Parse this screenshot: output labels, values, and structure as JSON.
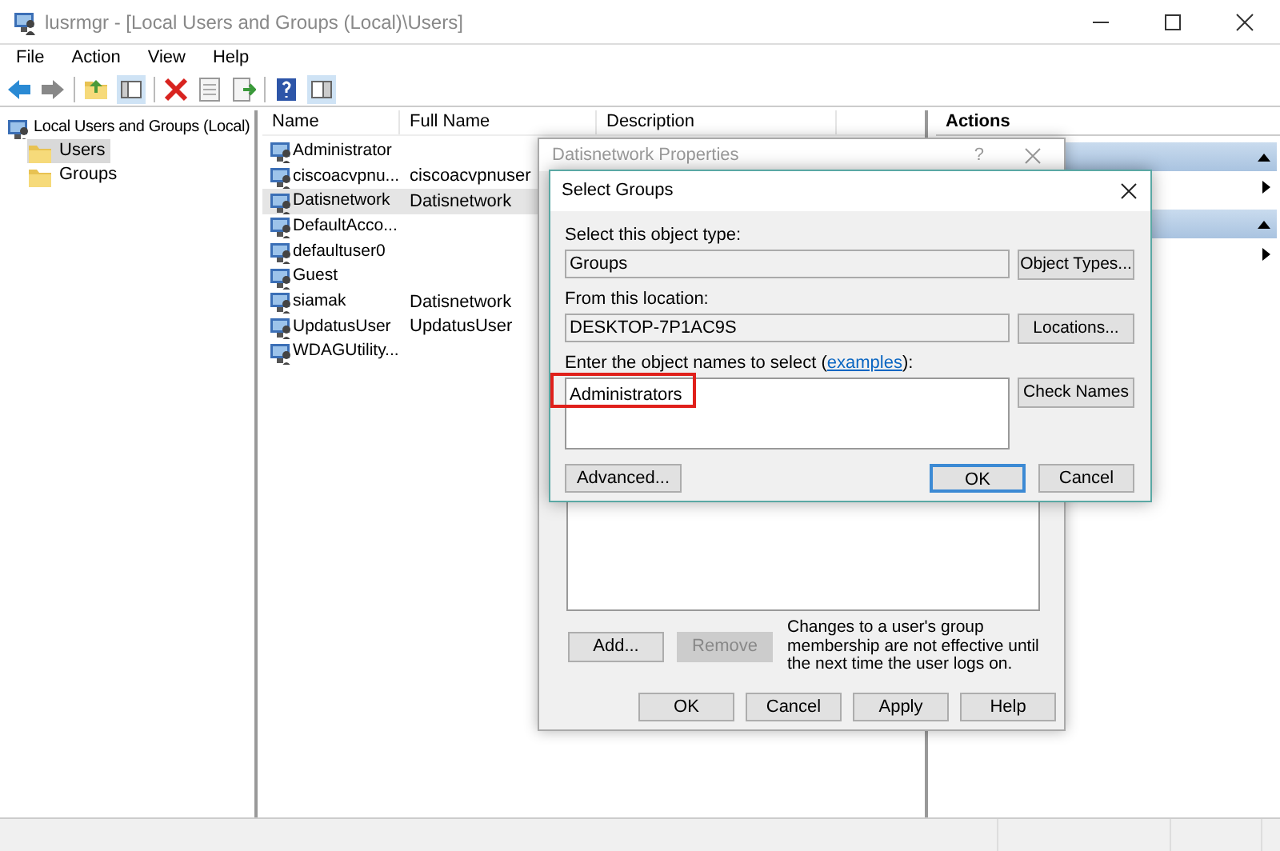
{
  "window": {
    "title": "lusrmgr - [Local Users and Groups (Local)\\Users]"
  },
  "menu": [
    "File",
    "Action",
    "View",
    "Help"
  ],
  "tree": {
    "label": "Local Users and Groups (Local)",
    "children": [
      {
        "label": "Users",
        "selected": true
      },
      {
        "label": "Groups",
        "selected": false
      }
    ]
  },
  "list": {
    "columns": [
      "Name",
      "Full Name",
      "Description"
    ],
    "rows": [
      {
        "name": "Administrator",
        "selected": false
      },
      {
        "name": "ciscoacvpnu...",
        "full_name": "ciscoacvpnuser",
        "selected": false
      },
      {
        "name": "Datisnetwork",
        "full_name": "Datisnetwork",
        "selected": true
      },
      {
        "name": "DefaultAcco...",
        "selected": false
      },
      {
        "name": "defaultuser0",
        "selected": false
      },
      {
        "name": "Guest",
        "selected": false
      },
      {
        "name": "siamak",
        "full_name": "Datisnetwork",
        "selected": false
      },
      {
        "name": "UpdatusUser",
        "full_name": "UpdatusUser",
        "selected": false
      },
      {
        "name": "WDAGUtility...",
        "selected": false
      }
    ]
  },
  "actions": {
    "title": "Actions"
  },
  "properties_dialog": {
    "title": "Datisnetwork Properties",
    "help": "?",
    "member_buttons": [
      {
        "label": "Add...",
        "disabled": false
      },
      {
        "label": "Remove",
        "disabled": true
      }
    ],
    "note": "Changes to a user's group membership are not effective until the next time the user logs on.",
    "buttons": [
      "OK",
      "Cancel",
      "Apply",
      "Help"
    ]
  },
  "select_groups": {
    "title": "Select Groups",
    "object_type_label": "Select this object type:",
    "object_type": "Groups",
    "object_types_button": "Object Types...",
    "location_label": "From this location:",
    "location": "DESKTOP-7P1AC9S",
    "locations_button": "Locations...",
    "names_label_start": "Enter the object names to select (",
    "examples_link": "examples",
    "names_label_end": "):",
    "names_value": "Administrators",
    "names_highlighted": true,
    "check_names_button": "Check Names",
    "advanced_button": "Advanced...",
    "ok_button": "OK",
    "cancel_button": "Cancel"
  }
}
